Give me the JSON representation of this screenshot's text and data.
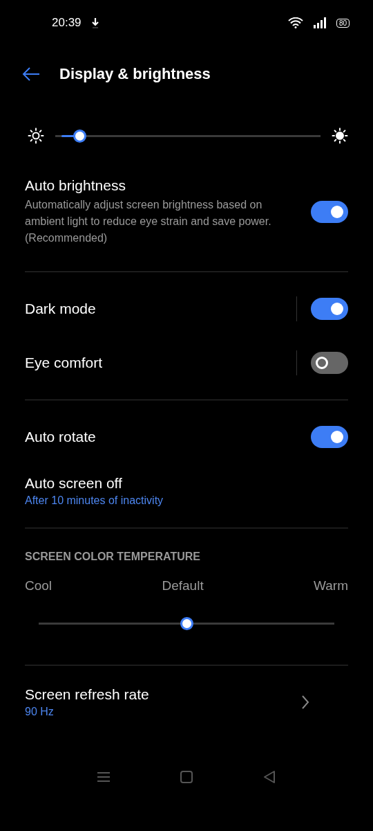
{
  "status_bar": {
    "time": "20:39",
    "battery": "80"
  },
  "header": {
    "title": "Display & brightness"
  },
  "brightness": {
    "level": 0.07
  },
  "groups": [
    {
      "items": [
        {
          "kind": "toggle",
          "title": "Auto brightness",
          "subtitle": "Automatically adjust screen brightness based on ambient light to reduce eye strain and save power. (Recommended)",
          "on": true,
          "separator": false
        }
      ]
    },
    {
      "items": [
        {
          "kind": "toggle",
          "title": "Dark mode",
          "on": true,
          "separator": true
        },
        {
          "kind": "toggle",
          "title": "Eye comfort",
          "on": false,
          "separator": true
        }
      ]
    },
    {
      "items": [
        {
          "kind": "toggle",
          "title": "Auto rotate",
          "on": true,
          "separator": false
        },
        {
          "kind": "link",
          "title": "Auto screen off",
          "value": "After 10 minutes of inactivity"
        }
      ]
    }
  ],
  "color_temperature": {
    "heading": "SCREEN COLOR TEMPERATURE",
    "labels": [
      "Cool",
      "Default",
      "Warm"
    ],
    "level": 0.5
  },
  "refresh_rate": {
    "kind": "nav",
    "title": "Screen refresh rate",
    "value": "90 Hz"
  }
}
